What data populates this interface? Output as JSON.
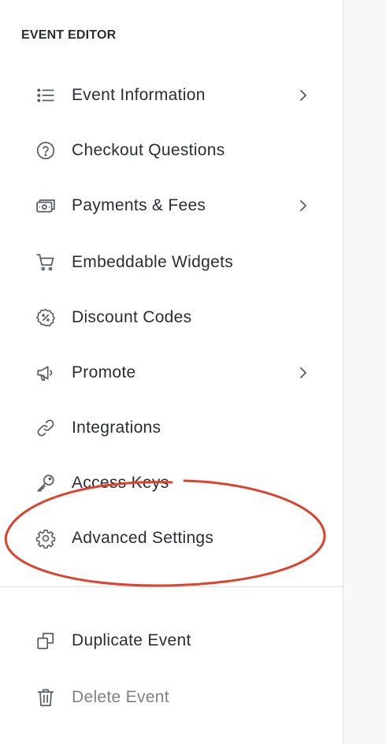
{
  "sidebar": {
    "section_title": "EVENT EDITOR",
    "items": [
      {
        "label": "Event Information",
        "icon": "list-icon",
        "has_submenu": true
      },
      {
        "label": "Checkout Questions",
        "icon": "question-circle-icon",
        "has_submenu": false
      },
      {
        "label": "Payments & Fees",
        "icon": "cash-icon",
        "has_submenu": true
      },
      {
        "label": "Embeddable Widgets",
        "icon": "cart-icon",
        "has_submenu": false
      },
      {
        "label": "Discount Codes",
        "icon": "discount-badge-icon",
        "has_submenu": false
      },
      {
        "label": "Promote",
        "icon": "megaphone-icon",
        "has_submenu": true
      },
      {
        "label": "Integrations",
        "icon": "link-icon",
        "has_submenu": false
      },
      {
        "label": "Access Keys",
        "icon": "key-icon",
        "has_submenu": false
      },
      {
        "label": "Advanced Settings",
        "icon": "gear-icon",
        "has_submenu": false
      }
    ],
    "actions": [
      {
        "label": "Duplicate Event",
        "icon": "duplicate-icon"
      },
      {
        "label": "Delete Event",
        "icon": "trash-icon"
      }
    ]
  },
  "colors": {
    "text": "#2b2d33",
    "muted_text": "#7d8086",
    "icon": "#5a5d63",
    "annotation": "#e0412c"
  }
}
